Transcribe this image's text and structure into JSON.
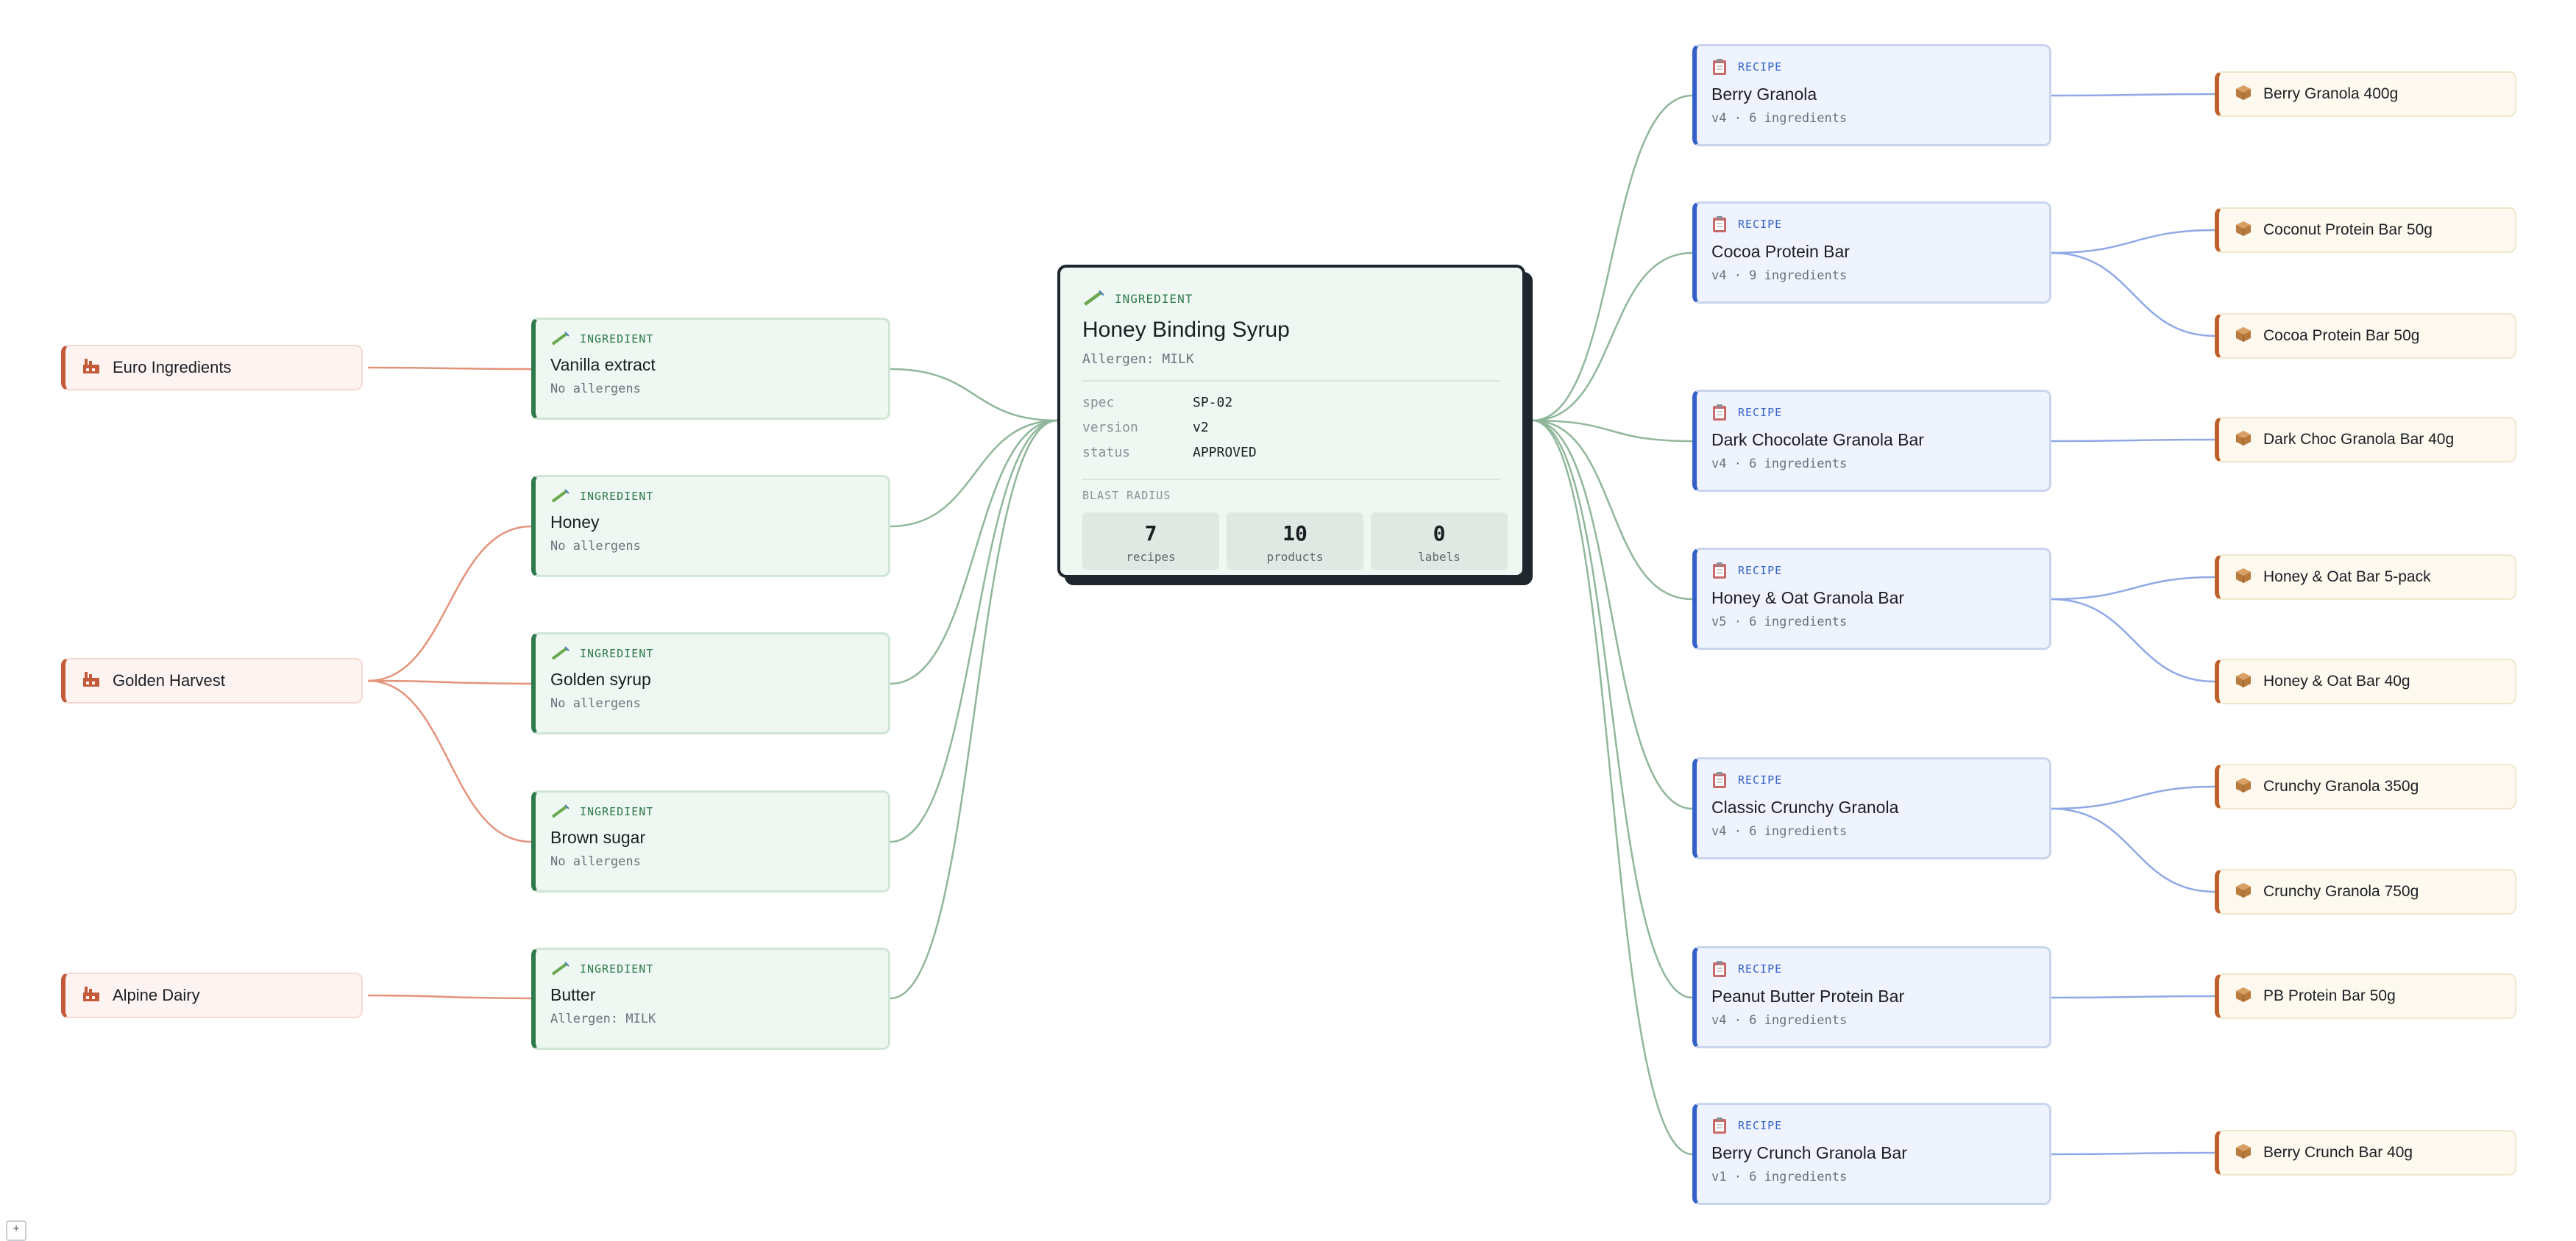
{
  "colors": {
    "supplier_accent": "#c35a3a",
    "ingredient_accent": "#2e7a4c",
    "recipe_accent": "#3461c9",
    "product_accent": "#c0602a",
    "edge_supplier": "#e3937a",
    "edge_ingredient": "#8fb79a",
    "edge_recipe": "#8ea9e6"
  },
  "icons": {
    "supplier": "factory-icon",
    "ingredient": "syringe-icon",
    "recipe": "clipboard-icon",
    "product": "package-icon"
  },
  "focus": {
    "type_label": "INGREDIENT",
    "name": "Honey Binding Syrup",
    "allergen": "Allergen: MILK",
    "spec_key": "spec",
    "spec_val": "SP-02",
    "version_key": "version",
    "version_val": "v2",
    "status_key": "status",
    "status_val": "APPROVED",
    "blast_label": "BLAST RADIUS",
    "stats": [
      {
        "num": "7",
        "label": "recipes"
      },
      {
        "num": "10",
        "label": "products"
      },
      {
        "num": "0",
        "label": "labels"
      }
    ]
  },
  "suppliers": [
    {
      "name": "Euro Ingredients"
    },
    {
      "name": "Golden Harvest"
    },
    {
      "name": "Alpine Dairy"
    }
  ],
  "ingredients": [
    {
      "type_label": "INGREDIENT",
      "name": "Vanilla extract",
      "allergen": "No allergens"
    },
    {
      "type_label": "INGREDIENT",
      "name": "Honey",
      "allergen": "No allergens"
    },
    {
      "type_label": "INGREDIENT",
      "name": "Golden syrup",
      "allergen": "No allergens"
    },
    {
      "type_label": "INGREDIENT",
      "name": "Brown sugar",
      "allergen": "No allergens"
    },
    {
      "type_label": "INGREDIENT",
      "name": "Butter",
      "allergen": "Allergen: MILK"
    }
  ],
  "recipes": [
    {
      "type_label": "RECIPE",
      "name": "Berry Granola",
      "meta": "v4 · 6 ingredients"
    },
    {
      "type_label": "RECIPE",
      "name": "Cocoa Protein Bar",
      "meta": "v4 · 9 ingredients"
    },
    {
      "type_label": "RECIPE",
      "name": "Dark Chocolate Granola Bar",
      "meta": "v4 · 6 ingredients"
    },
    {
      "type_label": "RECIPE",
      "name": "Honey & Oat Granola Bar",
      "meta": "v5 · 6 ingredients"
    },
    {
      "type_label": "RECIPE",
      "name": "Classic Crunchy Granola",
      "meta": "v4 · 6 ingredients"
    },
    {
      "type_label": "RECIPE",
      "name": "Peanut Butter Protein Bar",
      "meta": "v4 · 6 ingredients"
    },
    {
      "type_label": "RECIPE",
      "name": "Berry Crunch Granola Bar",
      "meta": "v1 · 6 ingredients"
    }
  ],
  "products": [
    {
      "name": "Berry Granola 400g"
    },
    {
      "name": "Coconut Protein Bar 50g"
    },
    {
      "name": "Cocoa Protein Bar 50g"
    },
    {
      "name": "Dark Choc Granola Bar 40g"
    },
    {
      "name": "Honey & Oat Bar 5-pack"
    },
    {
      "name": "Honey & Oat Bar 40g"
    },
    {
      "name": "Crunchy Granola 350g"
    },
    {
      "name": "Crunchy Granola 750g"
    },
    {
      "name": "PB Protein Bar 50g"
    },
    {
      "name": "Berry Crunch Bar 40g"
    }
  ],
  "controls": {
    "corner_button": "+"
  }
}
